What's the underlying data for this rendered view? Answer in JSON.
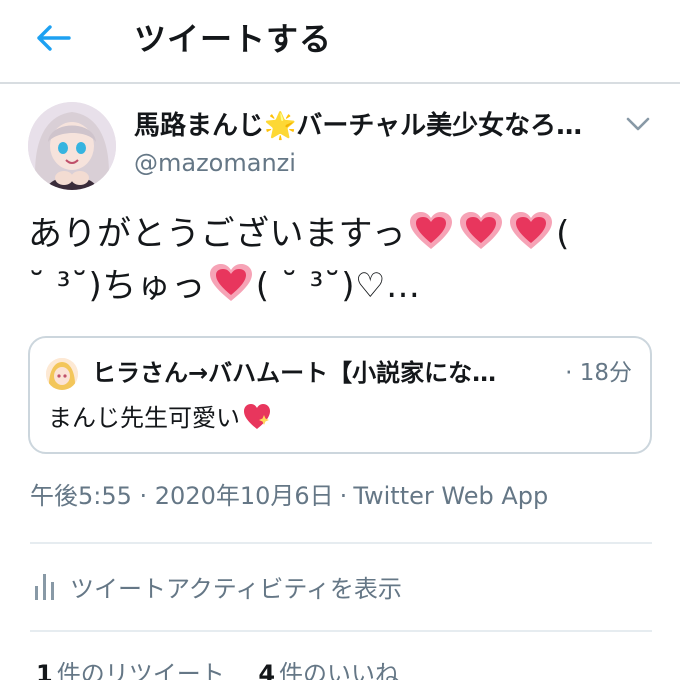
{
  "header": {
    "title": "ツイートする"
  },
  "tweet": {
    "display_name": "馬路まんじ",
    "display_name_rest": "バーチャル美少女なろ…",
    "username": "@mazomanzi",
    "text_part1": "ありがとうございますっ",
    "text_part2": "(",
    "text_part3": "˘ ³˘)ちゅっ",
    "text_part4": "( ˘ ³˘)♡…",
    "timestamp": "午後5:55 · 2020年10月6日",
    "source": "Twitter Web App"
  },
  "quote": {
    "name": "ヒラさん→バハムート【小説家にな…",
    "time": "· 18分",
    "text": "まんじ先生可愛い"
  },
  "activity": {
    "label": "ツイートアクティビティを表示"
  },
  "stats": {
    "retweets_count": "1",
    "retweets_label": "件のリツイート",
    "likes_count": "4",
    "likes_label": "件のいいね"
  },
  "colors": {
    "accent": "#1da1f2",
    "secondary_text": "#657786",
    "heart": "#e8365d"
  }
}
